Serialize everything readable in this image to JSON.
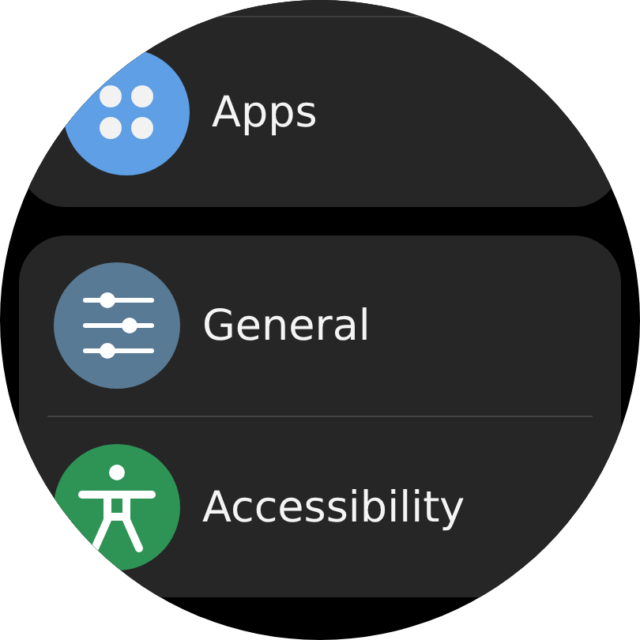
{
  "groups": [
    {
      "items": [
        {
          "label": "Apps",
          "kind": "apps",
          "color": "#5e9fe6"
        }
      ]
    },
    {
      "items": [
        {
          "label": "General",
          "kind": "settings",
          "color": "#587a94"
        },
        {
          "label": "Accessibility",
          "kind": "accessibility",
          "color": "#2e9455"
        }
      ]
    }
  ]
}
